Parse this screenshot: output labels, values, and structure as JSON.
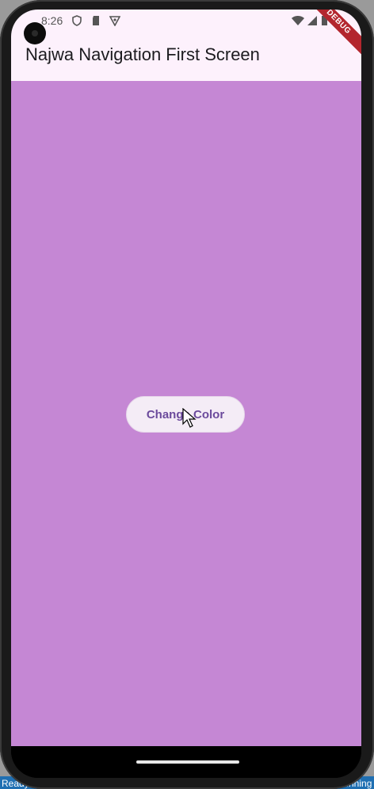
{
  "status_bar": {
    "time": "8:26",
    "left_icons": [
      "shield-icon",
      "sd-card-icon",
      "vpn-icon"
    ],
    "right_icons": [
      "wifi-icon",
      "cell-signal-icon",
      "battery-icon"
    ]
  },
  "debug_banner": "DEBUG",
  "app_bar": {
    "title": "Najwa Navigation First Screen"
  },
  "main": {
    "button_label": "Change Color",
    "background_color": "#c587d4"
  },
  "taskbar": {
    "items": [
      "Ready",
      "...",
      "...",
      "...",
      "...nning"
    ]
  },
  "colors": {
    "appbar": "#fdf1fc",
    "body": "#c587d4",
    "button_text": "#6b4a9c",
    "debug": "#b3262e"
  }
}
